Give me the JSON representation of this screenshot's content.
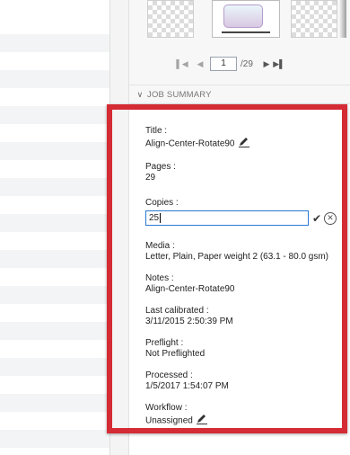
{
  "pager": {
    "first_icon": "first-page-icon",
    "prev_icon": "previous-page-icon",
    "next_icon": "next-page-icon",
    "last_icon": "last-page-icon",
    "current_page": "1",
    "total_pages": "/29"
  },
  "job_summary": {
    "header": "JOB SUMMARY",
    "collapse_icon": "chevron-down-icon",
    "title_label": "Title :",
    "title_value": "Align-Center-Rotate90",
    "pages_label": "Pages :",
    "pages_value": "29",
    "copies_label": "Copies :",
    "copies_value": "25",
    "media_label": "Media :",
    "media_value": "Letter, Plain, Paper weight 2 (63.1 - 80.0 gsm)",
    "notes_label": "Notes :",
    "notes_value": "Align-Center-Rotate90",
    "last_calibrated_label": "Last calibrated :",
    "last_calibrated_value": "3/11/2015 2:50:39 PM",
    "preflight_label": "Preflight :",
    "preflight_value": "Not Preflighted",
    "processed_label": "Processed :",
    "processed_value": "1/5/2017 1:54:07 PM",
    "workflow_label": "Workflow :",
    "workflow_value": "Unassigned"
  },
  "colors": {
    "highlight": "#d42b35",
    "input_focus": "#2b78d4"
  }
}
